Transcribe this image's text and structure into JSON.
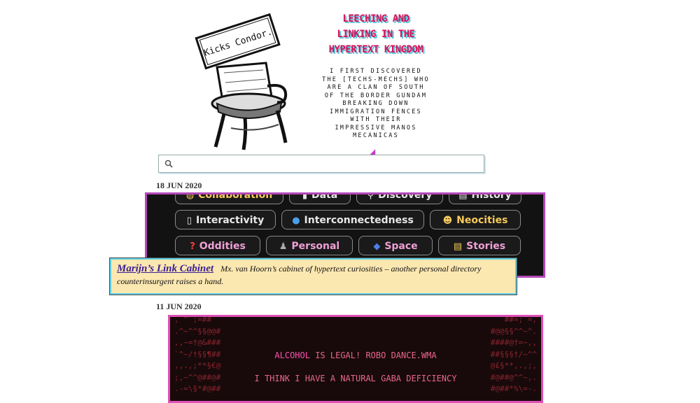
{
  "header": {
    "logo_text": "Kicks Condor.",
    "title_lines": [
      "LEECHING AND",
      "LINKING IN THE",
      "HYPERTEXT KINGDOM"
    ],
    "tagline_lines": [
      "I FIRST DISCOVERED",
      "THE [TECHS-MECHS] WHO",
      "ARE A CLAN OF SOUTH",
      "OF THE BORDER GUNDAM",
      "BREAKING DOWN",
      "IMMIGRATION FENCES",
      "WITH THEIR",
      "IMPRESSIVE MANOS",
      "MECANICAS"
    ]
  },
  "search": {
    "placeholder": "",
    "value": ""
  },
  "posts": [
    {
      "date": "18 JUN 2020",
      "categories": [
        {
          "label": "Collaboration",
          "icon": "handshake-icon"
        },
        {
          "label": "Data",
          "icon": "chart-icon"
        },
        {
          "label": "Discovery",
          "icon": "magnifier-icon"
        },
        {
          "label": "History",
          "icon": "scroll-icon"
        },
        {
          "label": "Interactivity",
          "icon": "mouse-icon"
        },
        {
          "label": "Interconnectedness",
          "icon": "globe-icon"
        },
        {
          "label": "Neocities",
          "icon": "cat-icon"
        },
        {
          "label": "Oddities",
          "icon": "question-icon"
        },
        {
          "label": "Personal",
          "icon": "person-icon"
        },
        {
          "label": "Space",
          "icon": "planet-icon"
        },
        {
          "label": "Stories",
          "icon": "memo-icon"
        }
      ],
      "link_card": {
        "title": "Marijn’s Link Cabinet",
        "description": "Mx. van Hoorn’s cabinet of hypertext curiosities – another personal directory",
        "description_cont": "counterinsurgent raises a hand."
      }
    },
    {
      "date": "11 JUN 2020",
      "ascii": {
        "highlight_word": "ALCOHOL",
        "line1_rest": " IS LEGAL! ROBO DANCE.WMA",
        "line2": "I THINK I HAVE A NATURAL GABA DEFICIENCY",
        "left_art": ", ^`;=##\n.^~^^§§@@#\n,,~=†@&###\n`^~/†§§¶##\n,,.,;**§€@\n;,~^^@##@#\n.-=\\§*#@##",
        "right_art": "##=;`=,\n#@@§§^^~^.\n####@†=~,,\n##§§§†/~^^\n@£§**,.,;,\n#@##@^^~,.\n#@##*%\\=-."
      }
    }
  ],
  "colors": {
    "accent": "#d4145a",
    "card_bg": "#fbe7b0",
    "purple_border": "#b447b8",
    "pink_border": "#e04fb7"
  }
}
